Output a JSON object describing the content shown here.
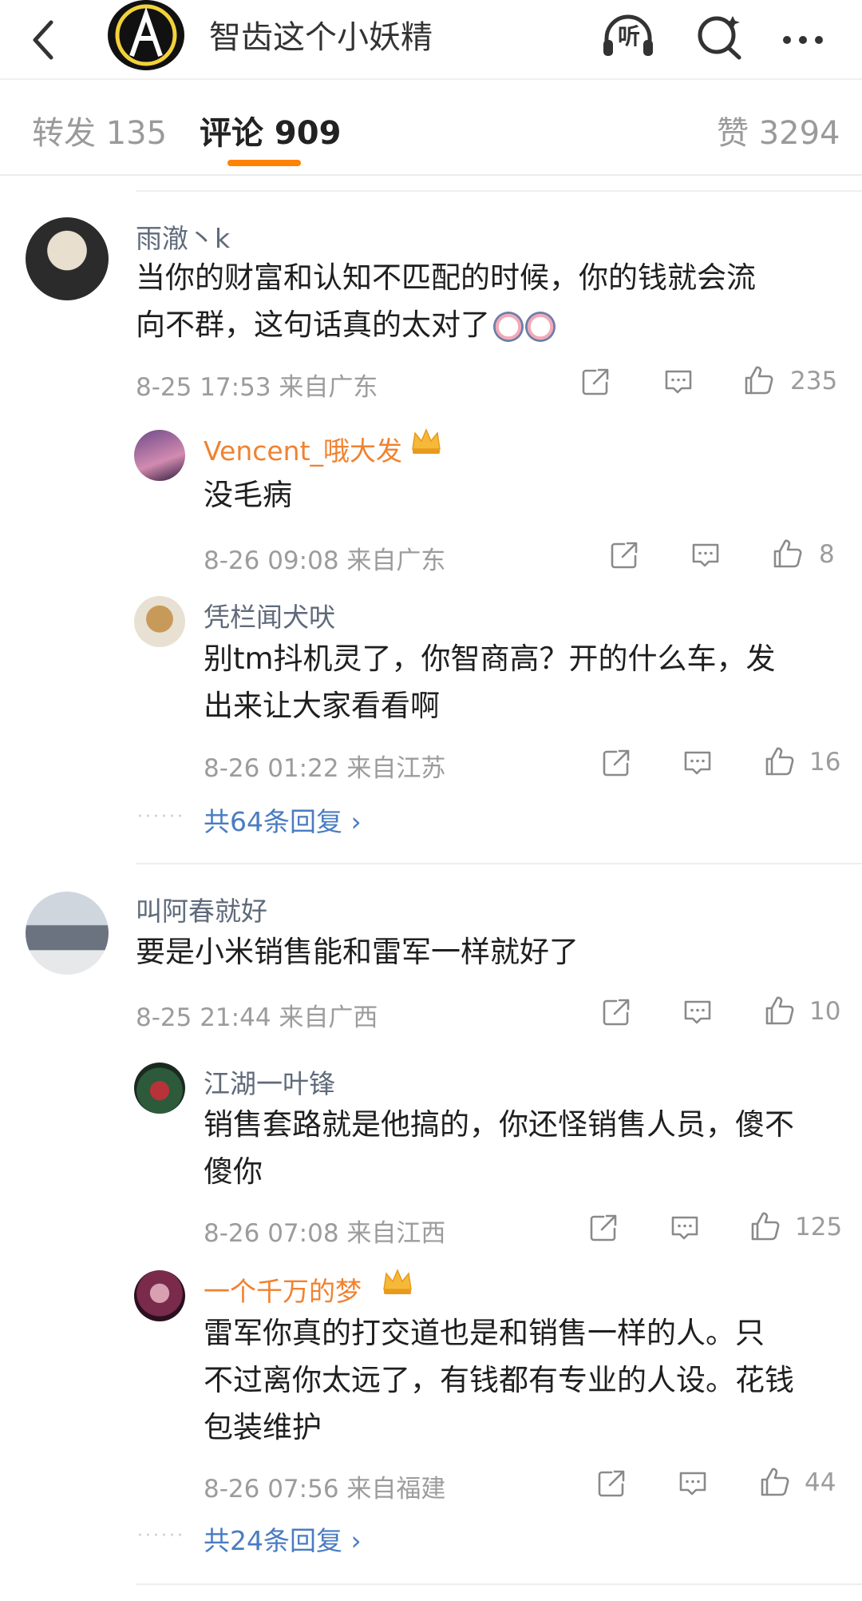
{
  "header": {
    "title": "智齿这个小妖精",
    "icons": [
      "back-icon",
      "listen-icon",
      "search-icon",
      "more-icon"
    ],
    "listen_label": "听"
  },
  "tabs": [
    {
      "label": "转发 135"
    },
    {
      "label": "评论 909"
    },
    {
      "label": "赞 3294"
    }
  ],
  "accent_color": "#ff8200",
  "comments": [
    {
      "user": "雨澈丶k",
      "text_lines": [
        "当你的财富和认知不匹配的时候，你的钱就会流",
        "向不群，这句话真的太对了"
      ],
      "time": "8-25 17:53 来自广东",
      "likes": "235",
      "replies": [
        {
          "user": "Vencent_哦大发",
          "text_lines": [
            "没毛病"
          ],
          "time": "8-26 09:08 来自广东",
          "likes": "8"
        },
        {
          "user": "凭栏闻犬吠",
          "text_lines": [
            "别tm抖机灵了，你智商高？开的什么车，发",
            "出来让大家看看啊"
          ],
          "time": "8-26 01:22 来自江苏",
          "likes": "16"
        }
      ],
      "more_replies": "共64条回复"
    },
    {
      "user": "叫阿春就好",
      "text_lines": [
        "要是小米销售能和雷军一样就好了"
      ],
      "time": "8-25 21:44 来自广西",
      "likes": "10",
      "replies": [
        {
          "user": "江湖一叶锋",
          "text_lines": [
            "销售套路就是他搞的，你还怪销售人员，傻不",
            "傻你"
          ],
          "time": "8-26 07:08 来自江西",
          "likes": "125"
        },
        {
          "user": "一个千万的梦",
          "text_lines": [
            "雷军你真的打交道也是和销售一样的人。只",
            "不过离你太远了，有钱都有专业的人设。花钱",
            "包装维护"
          ],
          "time": "8-26 07:56 来自福建",
          "likes": "44"
        }
      ],
      "more_replies": "共24条回复"
    }
  ],
  "dots": "······",
  "chevron": "›"
}
